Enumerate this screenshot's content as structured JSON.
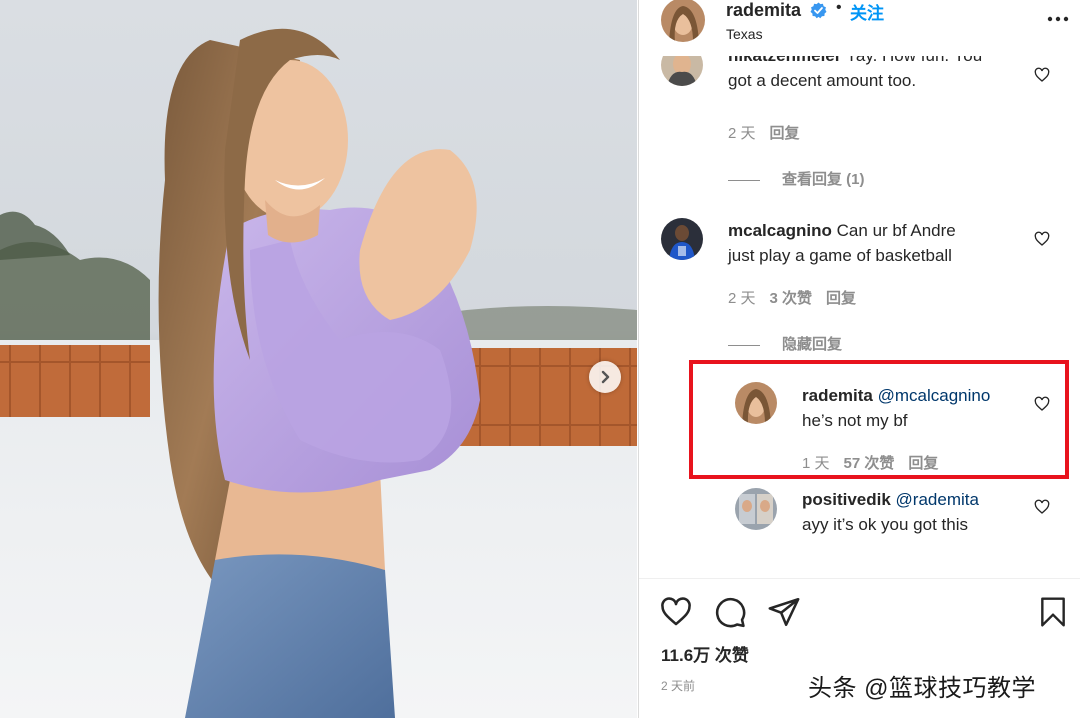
{
  "post": {
    "username": "rademita",
    "follow_label": "关注",
    "separator": "•",
    "location": "Texas"
  },
  "icons": {
    "verified": "verified-badge-icon",
    "more": "more-options-icon",
    "heart": "heart-icon",
    "comment": "comment-icon",
    "share": "send-icon",
    "save": "bookmark-icon",
    "next": "chevron-right-icon"
  },
  "colors": {
    "link": "#0095f6",
    "mention": "#00376b",
    "highlight": "#e8131d",
    "muted": "#8e8e8e"
  },
  "comments": [
    {
      "user": "nikatzenmeier",
      "text_line1": "Yay. How fun. You",
      "text_line2": "got a decent amount too.",
      "time": "2 天",
      "likes": "",
      "reply": "回复",
      "view_replies": "查看回复 (1)"
    },
    {
      "user": "mcalcagnino",
      "text_line1": "Can ur bf Andre",
      "text_line2": "just play a game of basketball",
      "time": "2 天",
      "likes": "3 次赞",
      "reply": "回复",
      "hide_replies": "隐藏回复"
    }
  ],
  "replies": [
    {
      "user": "rademita",
      "mention": "@mcalcagnino",
      "text": "he’s not my bf",
      "time": "1 天",
      "likes": "57 次赞",
      "reply": "回复"
    },
    {
      "user": "positivedik",
      "mention": "@rademita",
      "text": "ayy it’s ok you got this"
    }
  ],
  "footer": {
    "likes_count": "11.6万 次赞",
    "posted": "2 天前"
  },
  "watermark": "头条 @篮球技巧教学"
}
